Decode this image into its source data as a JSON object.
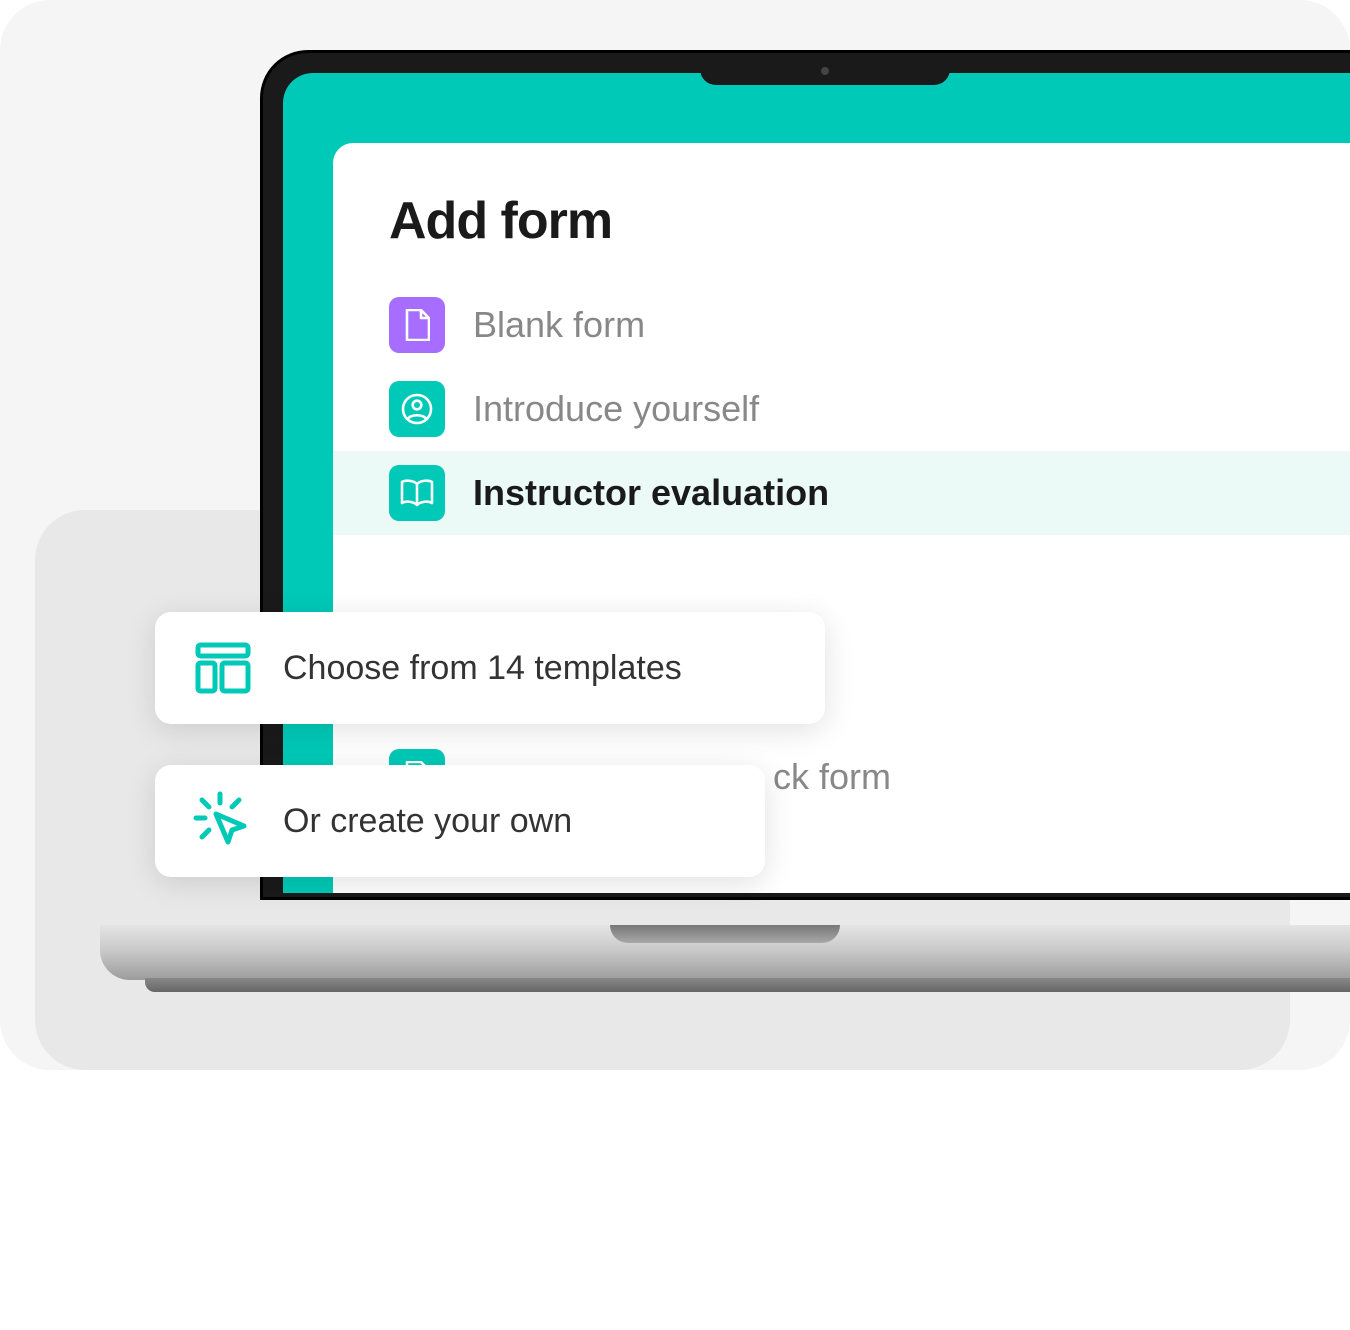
{
  "panel": {
    "title": "Add form",
    "items": [
      {
        "label": "Blank form",
        "icon": "document-icon",
        "color": "purple",
        "selected": false
      },
      {
        "label": "Introduce yourself",
        "icon": "person-circle-icon",
        "color": "teal",
        "selected": false
      },
      {
        "label": "Instructor evaluation",
        "icon": "book-icon",
        "color": "teal",
        "selected": true
      }
    ],
    "partial_item": {
      "label_fragment": "ck form",
      "icon": "document-icon",
      "color": "teal"
    }
  },
  "callouts": {
    "templates": {
      "text": "Choose from 14 templates"
    },
    "create_own": {
      "text": "Or create your own"
    }
  },
  "colors": {
    "accent_teal": "#00c9b7",
    "accent_purple": "#a66dff",
    "text_primary": "#1a1a1a",
    "text_secondary": "#888888"
  }
}
